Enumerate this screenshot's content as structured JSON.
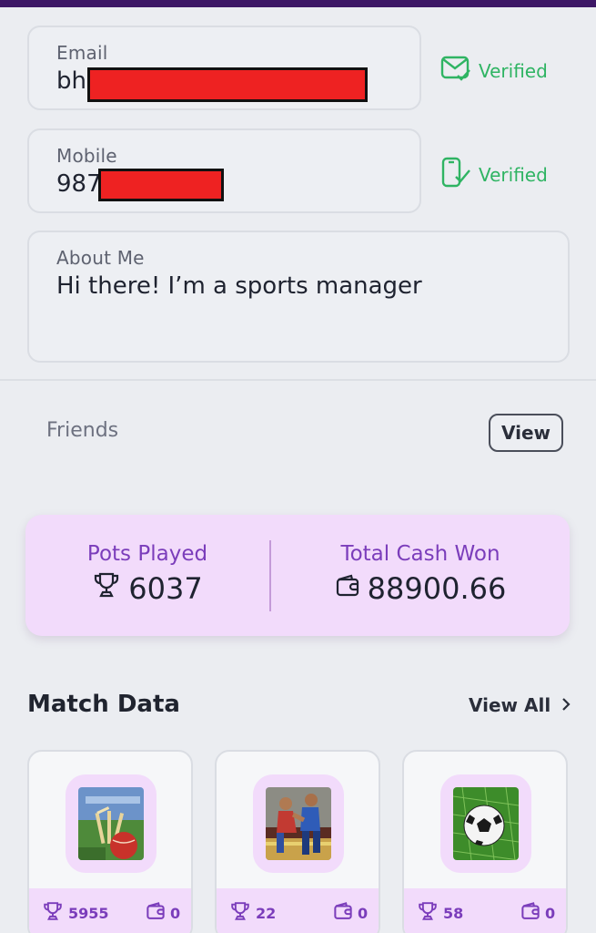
{
  "profile": {
    "email": {
      "label": "Email",
      "value_prefix": "bh",
      "status": "Verified",
      "status_icon": "email-verified-icon"
    },
    "mobile": {
      "label": "Mobile",
      "value_prefix": "987",
      "status": "Verified",
      "status_icon": "phone-verified-icon"
    },
    "about": {
      "label": "About Me",
      "value": "Hi there! I’m a sports manager"
    }
  },
  "friends": {
    "label": "Friends",
    "button": "View"
  },
  "stats": {
    "pots_played_label": "Pots Played",
    "pots_played_value": "6037",
    "total_cash_label": "Total Cash Won",
    "total_cash_value": "88900.66"
  },
  "match_data": {
    "title": "Match Data",
    "view_all": "View All",
    "cards": [
      {
        "sport": "cricket",
        "trophies": "5955",
        "cash": "0"
      },
      {
        "sport": "kabaddi",
        "trophies": "22",
        "cash": "0"
      },
      {
        "sport": "football",
        "trophies": "58",
        "cash": "0"
      }
    ]
  },
  "colors": {
    "accent_purple": "#7b3dbb",
    "verified_green": "#2fb463",
    "stats_bg": "#f2dbfb",
    "topbar": "#3d1766"
  }
}
